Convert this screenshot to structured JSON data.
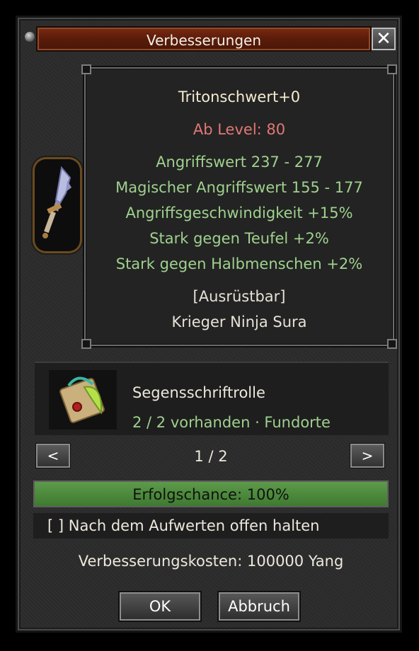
{
  "window": {
    "title": "Verbesserungen",
    "close_label": "✕"
  },
  "item": {
    "name": "Tritonschwert+0",
    "level_req": "Ab Level: 80",
    "stats": [
      "Angriffswert 237 - 277",
      "Magischer Angriffswert 155 - 177",
      "Angriffsgeschwindigkeit +15%",
      "Stark gegen Teufel +2%",
      "Stark gegen Halbmenschen +2%"
    ],
    "equip": "[Ausrüstbar]",
    "classes": "Krieger Ninja Sura",
    "icon": "sword-icon"
  },
  "material": {
    "name": "Segensschriftrolle",
    "count_text": "2 / 2 vorhanden · Fundorte",
    "icon": "scroll-icon"
  },
  "pager": {
    "prev": "<",
    "next": ">",
    "label": "1 / 2"
  },
  "chance": {
    "label": "Erfolgschance: 100%",
    "value": 100
  },
  "keep_open": {
    "label": "[ ] Nach dem Aufwerten offen halten"
  },
  "cost": {
    "label": "Verbesserungskosten: 100000 Yang"
  },
  "buttons": {
    "ok": "OK",
    "cancel": "Abbruch"
  },
  "colors": {
    "title_bar": "#5a1c0a",
    "stat_green": "#9fd18e",
    "level_red": "#e07874",
    "chance_fill": "#4f8a3e"
  }
}
